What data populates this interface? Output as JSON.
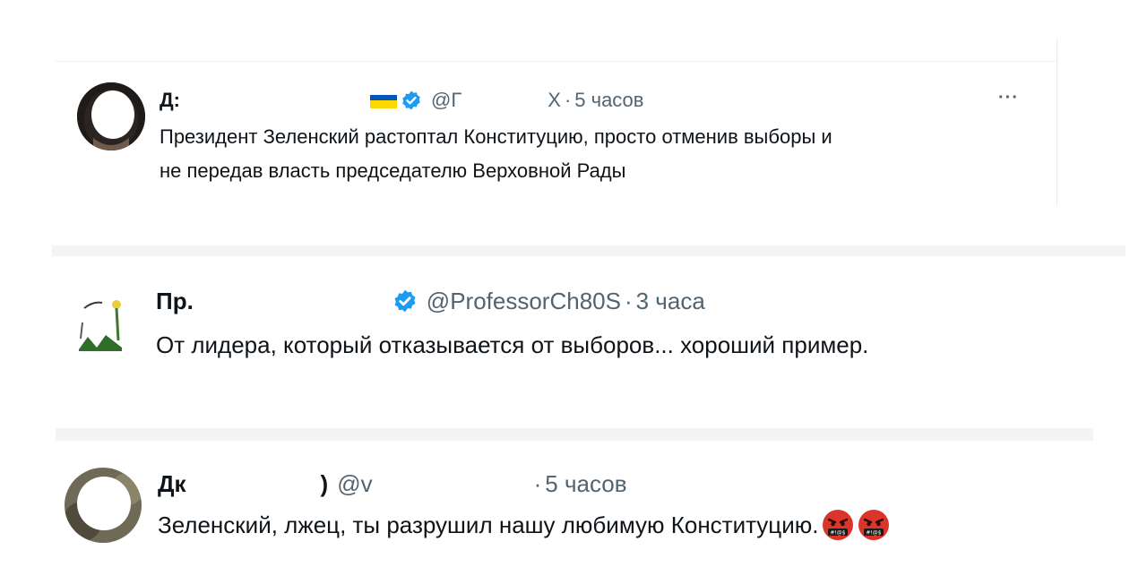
{
  "tweets": [
    {
      "name": "Д:",
      "handle": "@Г",
      "handle_tail": "X",
      "separator": "·",
      "time": "5 часов",
      "verified": true,
      "flag": true,
      "more": "···",
      "text_lines": [
        "Президент Зеленский растоптал Конституцию, просто отменив выборы и",
        "не передав власть председателю Верховной Рады"
      ]
    },
    {
      "name": "Пр.",
      "handle": "@ProfessorCh80S",
      "separator": "·",
      "time": "3 часа",
      "verified": true,
      "text": "От лидера, который отказывается от выборов... хороший пример."
    },
    {
      "name": "Дк",
      "paren": ")",
      "handle": "@v",
      "separator": "·",
      "time": "5 часов",
      "verified": false,
      "text": "Зеленский, лжец, ты разрушил нашу любимую Конституцию.",
      "emoji": [
        "angry-face-cursing-icon",
        "angry-face-cursing-icon"
      ]
    }
  ],
  "colors": {
    "verified": "#1d9bf0",
    "muted": "#536471",
    "text": "#0f1419",
    "divider": "#eff3f4",
    "flag_blue": "#0057b7",
    "flag_yellow": "#ffd700",
    "emoji_red": "#d9352b"
  }
}
